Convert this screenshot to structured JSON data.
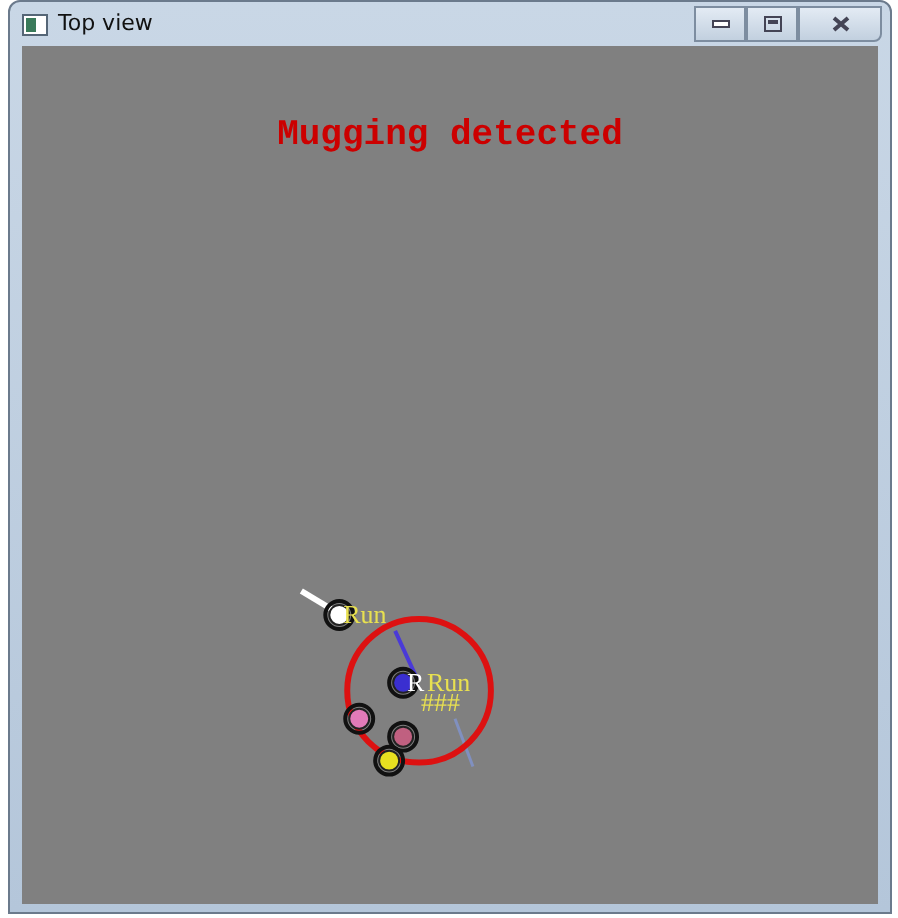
{
  "window": {
    "title": "Top view"
  },
  "alert": "Mugging detected",
  "agents": [
    {
      "color": "#ffffff",
      "labels": [
        "Run"
      ]
    },
    {
      "color": "#3a2fd0",
      "labels": [
        "R",
        "Run",
        "###"
      ]
    },
    {
      "color": "#e27ab8"
    },
    {
      "color": "#c06080"
    },
    {
      "color": "#e8e020"
    }
  ]
}
